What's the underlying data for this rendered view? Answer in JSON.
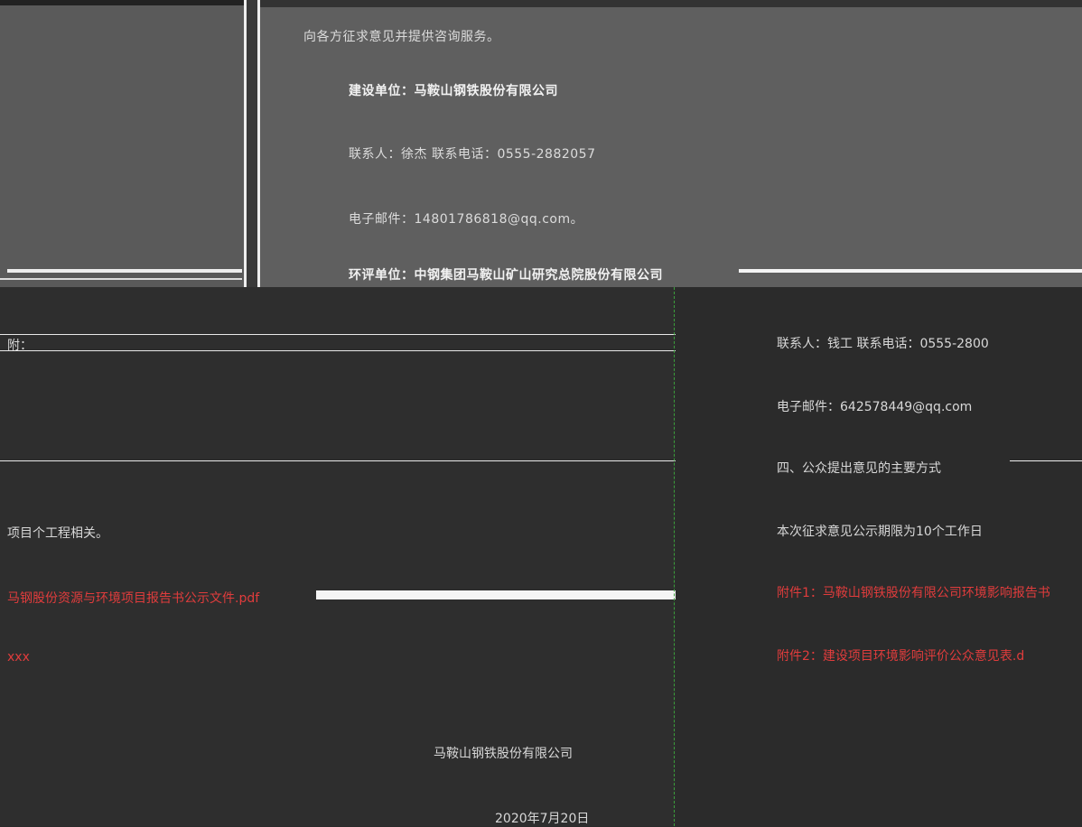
{
  "top_document": {
    "lines": [
      "向各方征求意见并提供咨询服务。",
      "建设单位：马鞍山钢铁股份有限公司",
      "联系人：徐杰    联系电话：0555-2882057",
      "电子邮件：14801786818@qq.com。",
      "环评单位：中钢集团马鞍山矿山研究总院股份有限公司"
    ]
  },
  "bottom_left": {
    "label_prefix": "附：",
    "project_note": "项目个工程相关。",
    "attachment_1": "马钢股份资源与环境项目报告书公示文件.pdf",
    "attachment_2": "xxx",
    "org": "马鞍山钢铁股份有限公司",
    "date": "2020年7月20日"
  },
  "bottom_right": {
    "contact": "联系人：钱工  联系电话：0555-2800",
    "email": "电子邮件：642578449@qq.com",
    "section_4": "四、公众提出意见的主要方式",
    "public_note": "本次征求意见公示期限为10个工作日",
    "attachment_1": "附件1：马鞍山钢铁股份有限公司环境影响报告书",
    "attachment_2": "附件2：建设项目环境影响评价公众意见表.d"
  },
  "colors": {
    "link_red": "#e03c3c",
    "separator_green": "#3aa03a"
  }
}
